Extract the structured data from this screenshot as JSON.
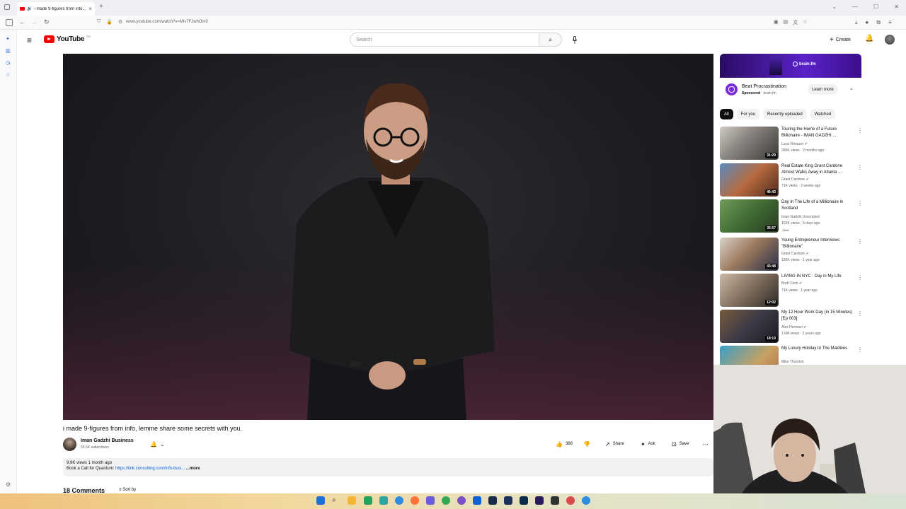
{
  "browser": {
    "tab_title": "i made 9-figures from info...",
    "url": "www.youtube.com/watch?v=Mlv7FJwhOm0"
  },
  "youtube": {
    "logo_text": "YouTube",
    "logo_country": "RS",
    "search_placeholder": "Search",
    "create_label": "Create"
  },
  "video": {
    "title": "i made 9-figures from info, lemme share some secrets with you.",
    "channel_name": "Iman Gadzhi Business",
    "subscribers": "55.5K subscribers",
    "likes": "388",
    "share_label": "Share",
    "ask_label": "Ask",
    "save_label": "Save",
    "views_date": "9.9K views  1 month ago",
    "desc_prefix": "Book a Call for Quantum: ",
    "desc_link": "https://link.consulting.com/info-busi...",
    "desc_more": "...more",
    "comments_count": "18 Comments",
    "sort_by": "Sort by"
  },
  "ad": {
    "brand": "brain.fm",
    "title": "Beat Procrastination",
    "sponsored": "Sponsored",
    "sponsor_domain": "brain.fm",
    "learn_more": "Learn more"
  },
  "chips": [
    "All",
    "For you",
    "Recently uploaded",
    "Watched"
  ],
  "recommendations": [
    {
      "title": "Touring the Home of a Future Billionaire - IMAN GADZHI ...",
      "channel": "Luca Yilmazer",
      "meta": "390K views · 2 months ago",
      "duration": "31:29",
      "badge": ""
    },
    {
      "title": "Real Estate King Grant Cardone Almost Walks Away in Atlanta ...",
      "channel": "Grant Cardone",
      "meta": "71K views · 2 weeks ago",
      "duration": "46:43",
      "badge": ""
    },
    {
      "title": "Day In The Life of a Millionaire in Scotland",
      "channel": "Iman Gadzhi Unscripted",
      "meta": "102K views · 5 days ago",
      "duration": "35:57",
      "badge": "New"
    },
    {
      "title": "Young Entrepreneur Interviews \"Billionaire\"",
      "channel": "Grant Cardone",
      "meta": "126K views · 1 year ago",
      "duration": "43:48",
      "badge": ""
    },
    {
      "title": "LIVING IN NYC : Day in My Life",
      "channel": "Brett Conti",
      "meta": "71K views · 1 year ago",
      "duration": "12:02",
      "badge": ""
    },
    {
      "title": "My 12 Hour Work Day (in 15 Minutes) [Ep 003]",
      "channel": "Alex Hormozi",
      "meta": "1.6M views · 2 years ago",
      "duration": "18:19",
      "badge": ""
    },
    {
      "title": "My Luxury Holiday to The Maldives",
      "channel": "Mike Thurston",
      "meta": "",
      "duration": "",
      "badge": ""
    }
  ]
}
